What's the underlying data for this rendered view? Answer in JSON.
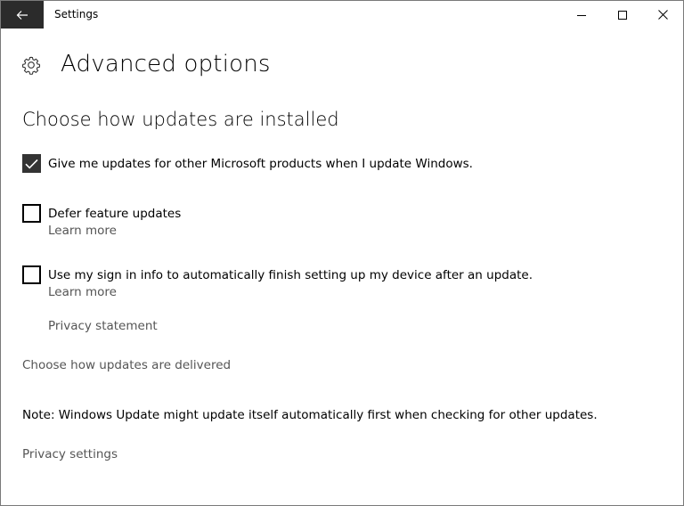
{
  "window": {
    "title": "Settings"
  },
  "header": {
    "title": "Advanced options",
    "icon": "gear-icon"
  },
  "section": {
    "title": "Choose how updates are installed"
  },
  "options": [
    {
      "label": "Give me updates for other Microsoft products when I update Windows.",
      "checked": true
    },
    {
      "label": "Defer feature updates",
      "checked": false,
      "link": "Learn more"
    },
    {
      "label": "Use my sign in info to automatically finish setting up my device after an update.",
      "checked": false,
      "link": "Learn more"
    }
  ],
  "links": {
    "privacy_statement": "Privacy statement",
    "delivery": "Choose how updates are delivered",
    "privacy_settings": "Privacy settings"
  },
  "note": "Note: Windows Update might update itself automatically first when checking for other updates.",
  "colors": {
    "back_button_bg": "#2b2b2b",
    "checkbox_checked_bg": "#333333",
    "link_text": "#555555"
  }
}
